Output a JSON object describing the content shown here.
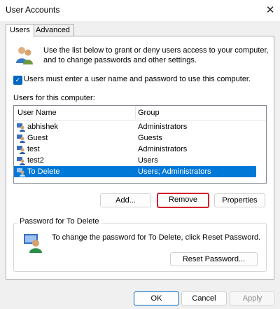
{
  "window": {
    "title": "User Accounts",
    "close_glyph": "✕"
  },
  "tabs": [
    {
      "label": "Users",
      "active": true
    },
    {
      "label": "Advanced",
      "active": false
    }
  ],
  "intro": {
    "text": "Use the list below to grant or deny users access to your computer, and to change passwords and other settings.",
    "icon": "users-icon"
  },
  "checkbox": {
    "label": "Users must enter a user name and password to use this computer.",
    "checked": true
  },
  "users_list": {
    "label": "Users for this computer:",
    "columns": [
      "User Name",
      "Group"
    ],
    "rows": [
      {
        "name": "abhishek",
        "group": "Administrators",
        "selected": false
      },
      {
        "name": "Guest",
        "group": "Guests",
        "selected": false
      },
      {
        "name": "test",
        "group": "Administrators",
        "selected": false
      },
      {
        "name": "test2",
        "group": "Users",
        "selected": false
      },
      {
        "name": "To Delete",
        "group": "Users; Administrators",
        "selected": true
      }
    ]
  },
  "list_buttons": {
    "add": "Add...",
    "remove": "Remove",
    "properties": "Properties"
  },
  "password_group": {
    "legend": "Password for To Delete",
    "text": "To change the password for To Delete, click Reset Password.",
    "reset_button": "Reset Password..."
  },
  "dialog_buttons": {
    "ok": "OK",
    "cancel": "Cancel",
    "apply": "Apply"
  },
  "colors": {
    "accent": "#0078d7",
    "highlight_border": "#d21f2a"
  }
}
